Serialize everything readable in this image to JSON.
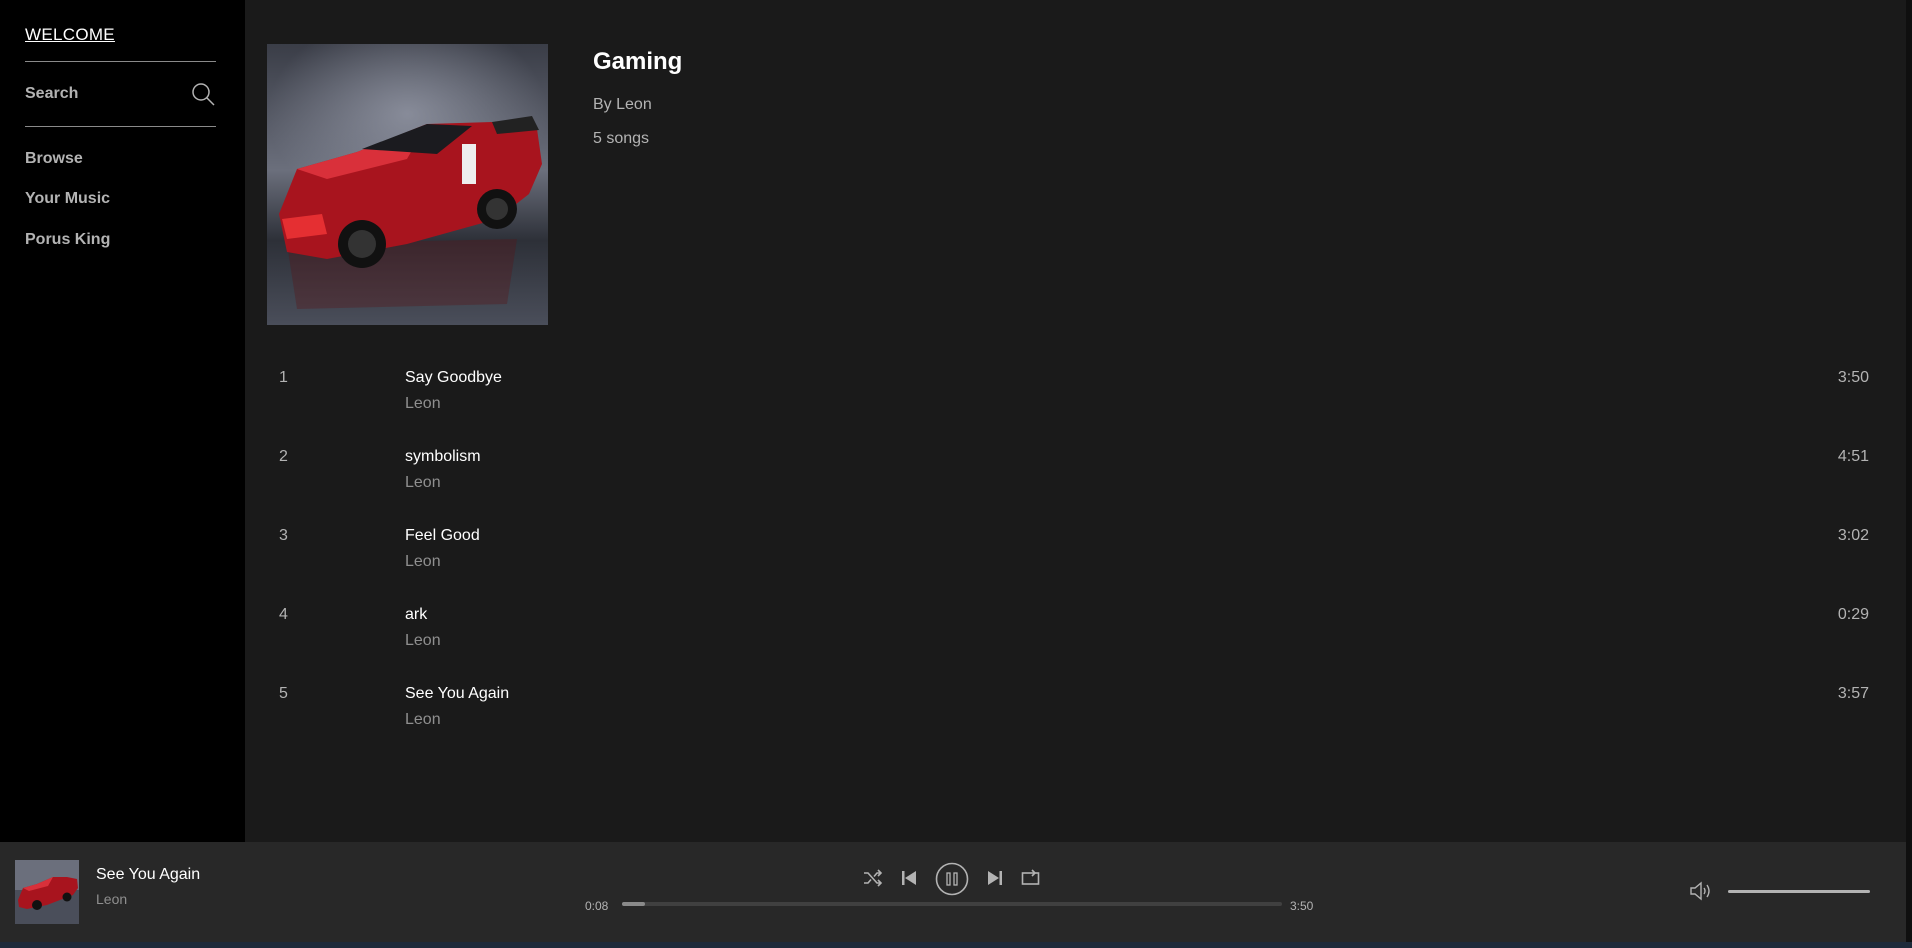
{
  "sidebar": {
    "welcome": "WELCOME",
    "search_label": "Search",
    "nav": [
      "Browse",
      "Your Music",
      "Porus King"
    ]
  },
  "album": {
    "title": "Gaming",
    "author": "By Leon",
    "song_count": "5 songs",
    "tracks": [
      {
        "num": "1",
        "title": "Say Goodbye",
        "artist": "Leon",
        "duration": "3:50"
      },
      {
        "num": "2",
        "title": "symbolism",
        "artist": "Leon",
        "duration": "4:51"
      },
      {
        "num": "3",
        "title": "Feel Good",
        "artist": "Leon",
        "duration": "3:02"
      },
      {
        "num": "4",
        "title": "ark",
        "artist": "Leon",
        "duration": "0:29"
      },
      {
        "num": "5",
        "title": "See You Again",
        "artist": "Leon",
        "duration": "3:57"
      }
    ]
  },
  "player": {
    "title": "See You Again",
    "artist": "Leon",
    "current_time": "0:08",
    "total_time": "3:50",
    "progress_fraction": 0.035,
    "volume_fraction": 1.0,
    "icons": [
      "shuffle-icon",
      "previous-icon",
      "pause-icon",
      "next-icon",
      "repeat-icon",
      "volume-icon",
      "search-icon"
    ]
  },
  "colors": {
    "sidebar_bg": "#000000",
    "main_bg": "#1a1a1a",
    "player_bg": "#282828",
    "text_primary": "#ffffff",
    "text_secondary": "#b3b3b3"
  }
}
